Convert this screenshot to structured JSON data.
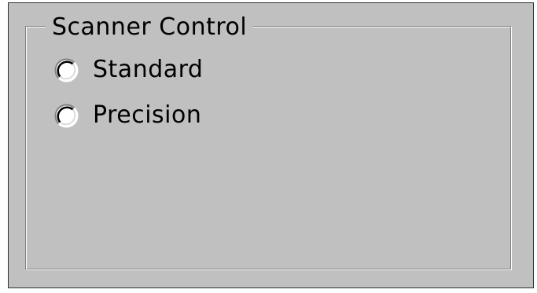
{
  "group": {
    "title": "Scanner Control"
  },
  "options": [
    {
      "label": "Standard",
      "selected": false,
      "icon": "radio-unchecked-icon"
    },
    {
      "label": "Precision",
      "selected": false,
      "icon": "radio-unchecked-icon"
    }
  ],
  "colors": {
    "panel_background": "#c0c0c0",
    "text": "#000000",
    "highlight": "#ffffff",
    "shadow": "#808080"
  }
}
